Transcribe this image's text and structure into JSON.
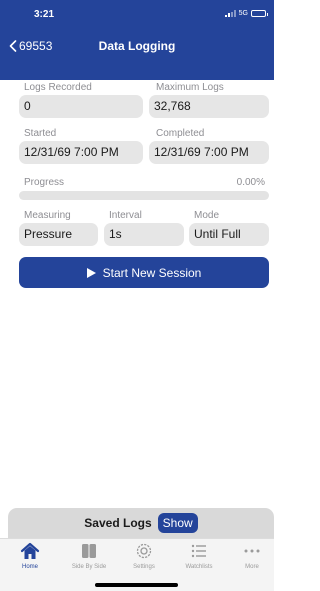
{
  "status": {
    "time": "3:21",
    "network": "5G"
  },
  "nav": {
    "back_label": "69553",
    "title": "Data Logging"
  },
  "fields": {
    "logs_recorded": {
      "label": "Logs Recorded",
      "value": "0"
    },
    "maximum_logs": {
      "label": "Maximum Logs",
      "value": "32,768"
    },
    "started": {
      "label": "Started",
      "value": "12/31/69 7:00 PM"
    },
    "completed": {
      "label": "Completed",
      "value": "12/31/69 7:00 PM"
    },
    "progress": {
      "label": "Progress",
      "value_text": "0.00%",
      "fraction": 0
    },
    "measuring": {
      "label": "Measuring",
      "value": "Pressure"
    },
    "interval": {
      "label": "Interval",
      "value": "1s"
    },
    "mode": {
      "label": "Mode",
      "value": "Until Full"
    }
  },
  "start_button": {
    "label": "Start New Session",
    "icon": "play-icon"
  },
  "saved_logs": {
    "title": "Saved Logs",
    "show_label": "Show"
  },
  "tabs": [
    {
      "label": "Home",
      "icon": "home-icon",
      "active": true
    },
    {
      "label": "Side By Side",
      "icon": "side-by-side-icon",
      "active": false
    },
    {
      "label": "Settings",
      "icon": "gear-icon",
      "active": false
    },
    {
      "label": "Watchlists",
      "icon": "list-icon",
      "active": false
    },
    {
      "label": "More",
      "icon": "more-icon",
      "active": false
    }
  ],
  "colors": {
    "accent": "#24449a",
    "field_bg": "#e6e6e6",
    "label": "#8e8e93"
  }
}
